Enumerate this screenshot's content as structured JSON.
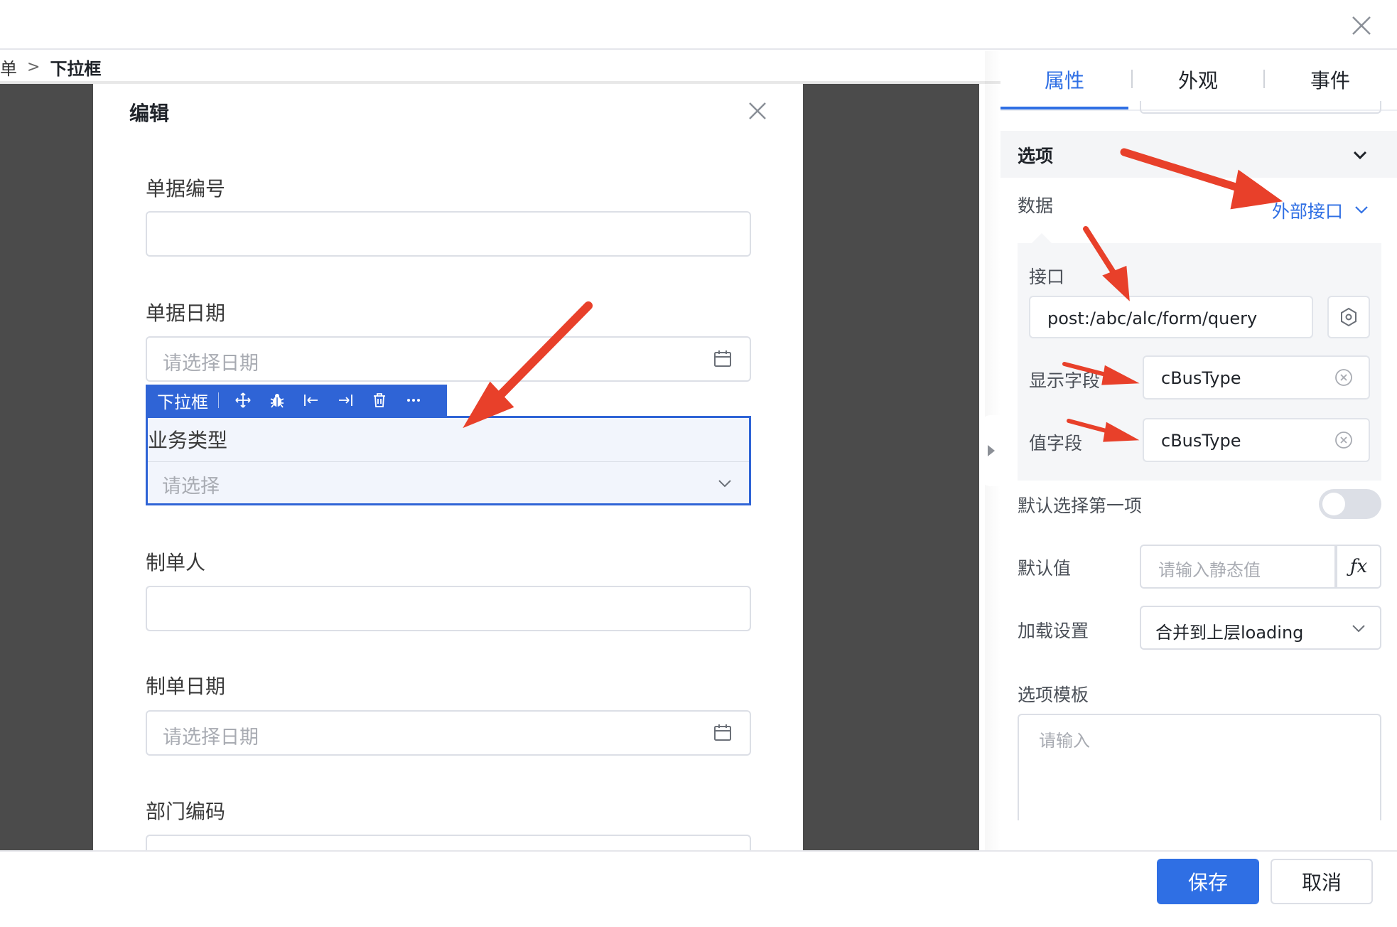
{
  "breadcrumb": {
    "prev": "表单",
    "separator": ">",
    "current": "下拉框"
  },
  "modal": {
    "title": "编辑",
    "fields": [
      {
        "label": "单据编号",
        "placeholder": ""
      },
      {
        "label": "单据日期",
        "placeholder": "请选择日期"
      },
      {
        "label": "制单人",
        "placeholder": ""
      },
      {
        "label": "制单日期",
        "placeholder": "请选择日期"
      },
      {
        "label": "部门编码",
        "placeholder": ""
      }
    ],
    "selected": {
      "toolbar_name": "下拉框",
      "label": "业务类型",
      "placeholder": "请选择"
    }
  },
  "panel": {
    "tabs": [
      "属性",
      "外观",
      "事件"
    ],
    "active_tab": "属性",
    "section_title": "选项",
    "data_label": "数据",
    "data_value": "外部接口",
    "api_label": "接口",
    "api_value": "post:/abc/alc/form/query",
    "display_field_label": "显示字段",
    "display_field_value": "cBusType",
    "value_field_label": "值字段",
    "value_field_value": "cBusType",
    "default_first_label": "默认选择第一项",
    "default_first_on": false,
    "default_value_label": "默认值",
    "default_value_placeholder": "请输入静态值",
    "fx_label": "ƒx",
    "loading_label": "加载设置",
    "loading_value": "合并到上层loading",
    "template_label": "选项模板",
    "template_placeholder": "请输入"
  },
  "footer": {
    "save": "保存",
    "cancel": "取消"
  },
  "colors": {
    "accent": "#2f6fe4",
    "selection": "#2f64d6",
    "canvas": "#4b4b4b",
    "annotation": "#e8402a"
  }
}
